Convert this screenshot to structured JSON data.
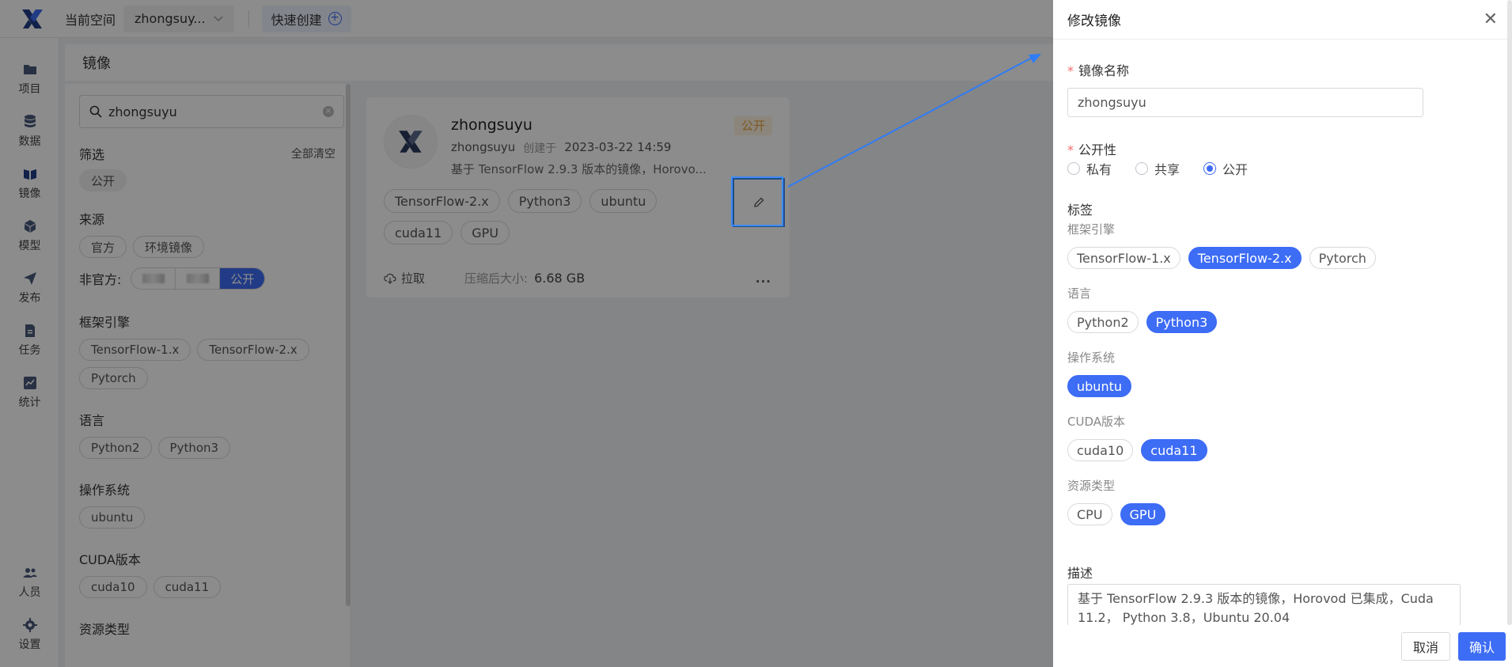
{
  "topbar": {
    "space_label": "当前空间",
    "space_value": "zhongsuy...",
    "quick_create": "快速创建"
  },
  "nav": [
    {
      "label": "项目",
      "icon": "folder-icon"
    },
    {
      "label": "数据",
      "icon": "database-icon"
    },
    {
      "label": "镜像",
      "icon": "image-icon"
    },
    {
      "label": "模型",
      "icon": "cube-icon"
    },
    {
      "label": "发布",
      "icon": "send-icon"
    },
    {
      "label": "任务",
      "icon": "task-icon"
    },
    {
      "label": "统计",
      "icon": "chart-icon"
    },
    {
      "label": "人员",
      "icon": "users-icon"
    },
    {
      "label": "设置",
      "icon": "gear-icon"
    }
  ],
  "page": {
    "title": "镜像"
  },
  "filter": {
    "search_value": "zhongsuyu",
    "filter_title": "筛选",
    "clear_all": "全部清空",
    "active_chip": "公开",
    "source_title": "来源",
    "source_chips": [
      "官方",
      "环境镜像"
    ],
    "unofficial_label": "非官方:",
    "unofficial_active": "公开",
    "framework_title": "框架引擎",
    "framework_chips": [
      "TensorFlow-1.x",
      "TensorFlow-2.x",
      "Pytorch"
    ],
    "language_title": "语言",
    "language_chips": [
      "Python2",
      "Python3"
    ],
    "os_title": "操作系统",
    "os_chips": [
      "ubuntu"
    ],
    "cuda_title": "CUDA版本",
    "cuda_chips": [
      "cuda10",
      "cuda11"
    ],
    "resource_title": "资源类型"
  },
  "card": {
    "title": "zhongsuyu",
    "badge": "公开",
    "owner": "zhongsuyu",
    "created_label": "创建于",
    "created_at": "2023-03-22 14:59",
    "desc": "基于 TensorFlow 2.9.3 版本的镜像，Horovo...",
    "tags": [
      "TensorFlow-2.x",
      "Python3",
      "ubuntu",
      "cuda11",
      "GPU"
    ],
    "pull": "拉取",
    "size_label": "压缩后大小:",
    "size": "6.68 GB",
    "more": "..."
  },
  "drawer": {
    "title": "修改镜像",
    "name_label": "镜像名称",
    "name_value": "zhongsuyu",
    "visibility_label": "公开性",
    "visibility_options": [
      "私有",
      "共享",
      "公开"
    ],
    "visibility_selected": "公开",
    "tags_label": "标签",
    "framework_label": "框架引擎",
    "framework": [
      "TensorFlow-1.x",
      "TensorFlow-2.x",
      "Pytorch"
    ],
    "language_label": "语言",
    "language": [
      "Python2",
      "Python3"
    ],
    "os_label": "操作系统",
    "os": [
      "ubuntu"
    ],
    "cuda_label": "CUDA版本",
    "cuda": [
      "cuda10",
      "cuda11"
    ],
    "resource_label": "资源类型",
    "resource": [
      "CPU",
      "GPU"
    ],
    "desc_label": "描述",
    "desc_value": "基于 TensorFlow 2.9.3 版本的镜像，Horovod 已集成，Cuda 11.2， Python 3.8，Ubuntu 20.04",
    "cancel": "取消",
    "confirm": "确认"
  },
  "colors": {
    "accent": "#3d6cf5",
    "badge_bg": "#fdf3e1",
    "badge_text": "#e6a23c"
  }
}
